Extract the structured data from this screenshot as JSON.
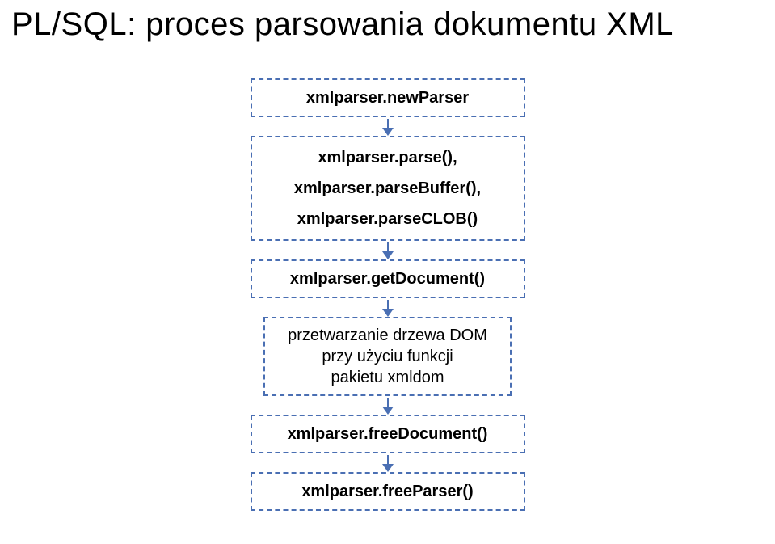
{
  "title": "PL/SQL: proces parsowania dokumentu XML",
  "steps": {
    "newParser": "xmlparser.newParser",
    "parse1": "xmlparser.parse(),",
    "parse2": "xmlparser.parseBuffer(),",
    "parse3": "xmlparser.parseCLOB()",
    "getDocument": "xmlparser.getDocument()",
    "process1": "przetwarzanie drzewa DOM",
    "process2": "przy użyciu funkcji",
    "process3": "pakietu xmldom",
    "freeDocument": "xmlparser.freeDocument()",
    "freeParser": "xmlparser.freeParser()"
  }
}
